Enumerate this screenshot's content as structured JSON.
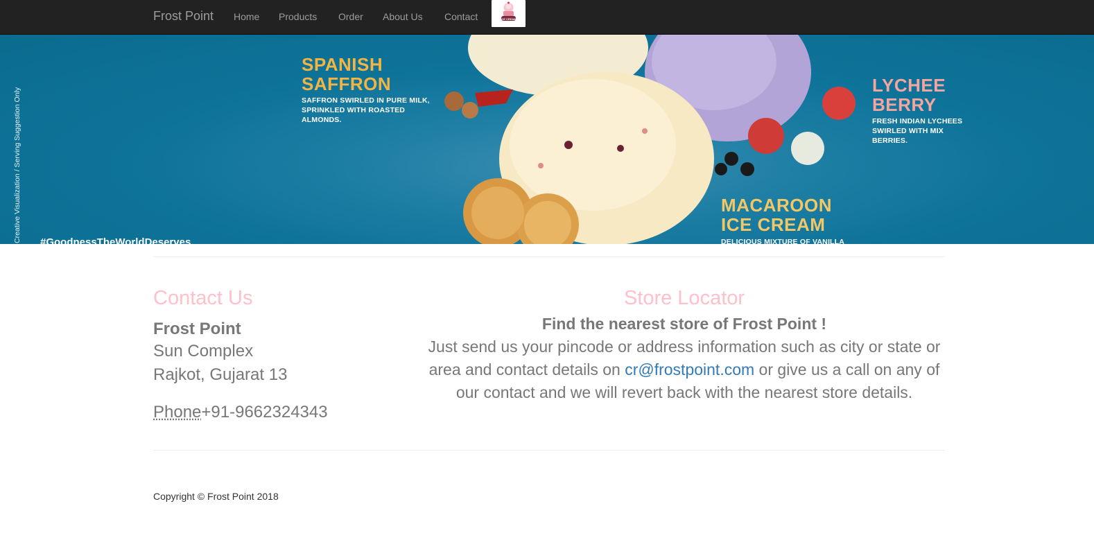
{
  "navbar": {
    "brand": "Frost Point",
    "items": [
      "Home",
      "Products",
      "Order",
      "About Us",
      "Contact"
    ],
    "logo_text": "ICE CREAM"
  },
  "banner": {
    "side_note": "Creative Visualization / Serving Suggestion Only",
    "hashtag": "#GoodnessTheWorldDeserves",
    "flavors": [
      {
        "name_line1": "SPANISH",
        "name_line2": "SAFFRON",
        "desc_lines": [
          "SAFFRON SWIRLED IN PURE MILK,",
          "SPRINKLED WITH ROASTED",
          "ALMONDS."
        ]
      },
      {
        "name_line1": "LYCHEE",
        "name_line2": "BERRY",
        "desc_lines": [
          "FRESH INDIAN LYCHEES",
          "SWIRLED WITH MIX",
          "BERRIES."
        ]
      },
      {
        "name_line1": "MACAROON",
        "name_line2": "ICE CREAM",
        "desc_lines": [
          "DELICIOUS MIXTURE OF VANILLA"
        ]
      }
    ]
  },
  "contact": {
    "title": "Contact Us",
    "name": "Frost Point",
    "street": "Sun Complex",
    "city": "Rajkot, Gujarat 13",
    "phone_label": "Phone",
    "phone": "+91-9662324343"
  },
  "store": {
    "title": "Store Locator",
    "heading": "Find the nearest store of Frost Point !",
    "text_before": "Just send us your pincode or address information such as city or state or area and contact details on ",
    "email": "cr@frostpoint.com",
    "text_after": " or give us a call on any of our contact and we will revert back with the nearest store details."
  },
  "footer": {
    "copyright": "Copyright © Frost Point 2018"
  },
  "colors": {
    "navbar_bg": "#222222",
    "banner_bg": "#0e7399",
    "accent_pink": "#ffc0cb",
    "saffron_gold": "#f2b544",
    "lychee_pink": "#f3a6a0",
    "macaroon_gold": "#f2c766",
    "link": "#337ab7"
  }
}
